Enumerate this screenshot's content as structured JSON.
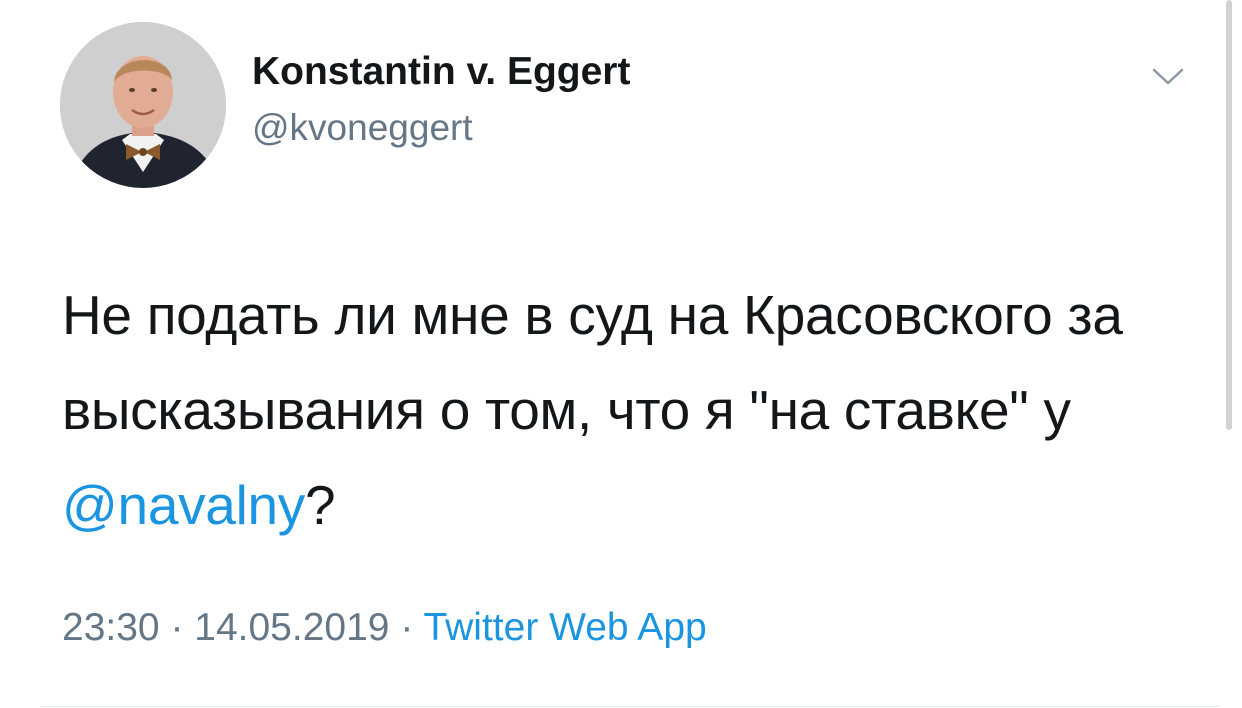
{
  "author": {
    "display_name": "Konstantin v. Eggert",
    "handle": "@kvoneggert",
    "avatar_icon": "profile-photo"
  },
  "menu": {
    "icon": "chevron-down-icon"
  },
  "tweet": {
    "text_before": "Не подать ли мне в суд на Красовского за высказывания о том, что я \"на ставке\" у ",
    "mention": "@navalny",
    "text_after": "?"
  },
  "meta": {
    "time": "23:30",
    "separator": " · ",
    "date": "14.05.2019",
    "source": "Twitter Web App"
  },
  "colors": {
    "text": "#14171a",
    "secondary": "#657786",
    "link": "#1b95e0"
  }
}
